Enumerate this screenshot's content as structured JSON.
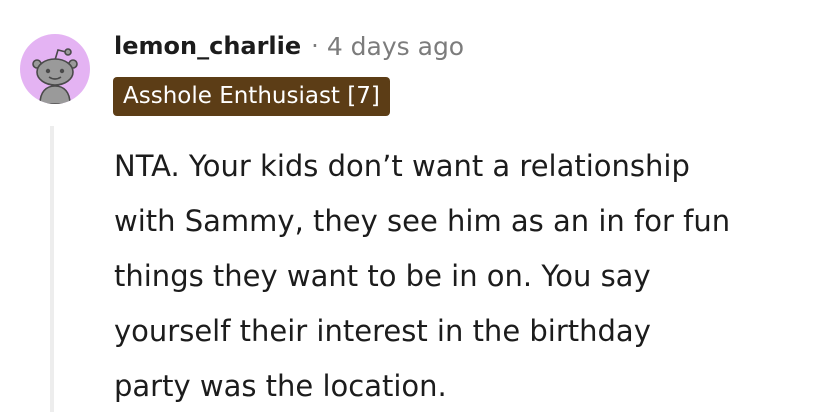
{
  "comment": {
    "username": "lemon_charlie",
    "separator": "·",
    "timestamp": "4 days ago",
    "flair": "Asshole Enthusiast [7]",
    "body_lines": [
      "NTA. Your kids don’t want a relationship",
      "with Sammy, they see him as an in for fun",
      "things they want to be in on. You say",
      "yourself their interest in the birthday",
      "party was the location."
    ]
  },
  "colors": {
    "avatar_background": "#e4b3f3",
    "avatar_figure": "#8c8c8c",
    "flair_background": "#5c3d16",
    "flair_text": "#ffffff",
    "username_text": "#1c1c1c",
    "timestamp_text": "#7c7c7c",
    "thread_line": "#ededed"
  },
  "icons": {
    "avatar": "snoo-avatar-icon"
  }
}
